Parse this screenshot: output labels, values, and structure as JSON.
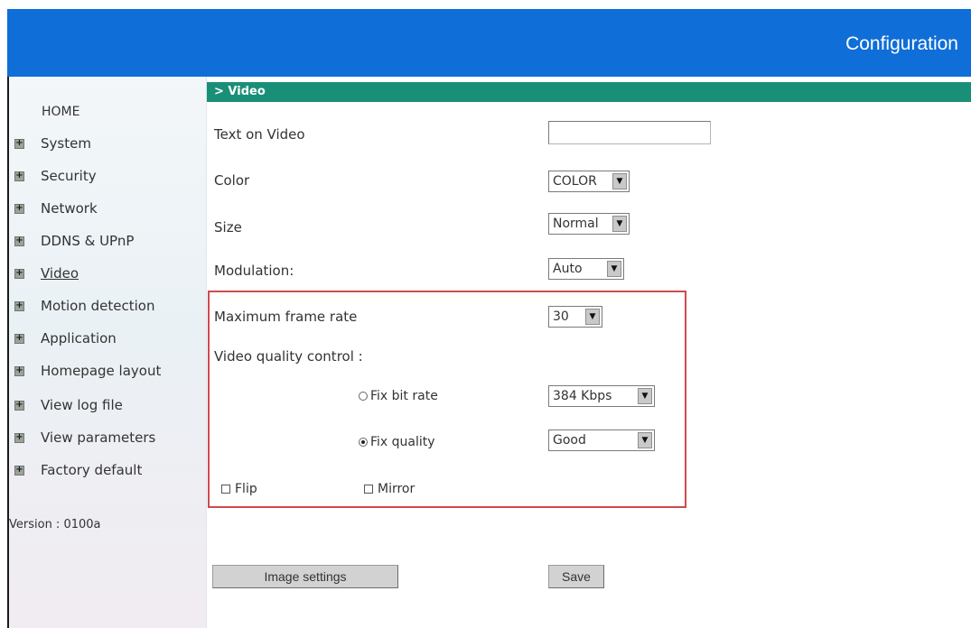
{
  "header": {
    "title": "Configuration"
  },
  "sidebar": {
    "home": "HOME",
    "items": [
      {
        "label": "System",
        "icon": "plus-box-icon"
      },
      {
        "label": "Security",
        "icon": "plus-box-icon"
      },
      {
        "label": "Network",
        "icon": "plus-box-icon"
      },
      {
        "label": "DDNS & UPnP",
        "icon": "plus-box-icon"
      },
      {
        "label": "Video",
        "icon": "plus-box-icon"
      },
      {
        "label": "Motion detection",
        "icon": "plus-box-icon"
      },
      {
        "label": "Application",
        "icon": "plus-box-icon"
      },
      {
        "label": "Homepage layout",
        "icon": "plus-box-icon"
      },
      {
        "label": "View log file",
        "icon": "plus-box-icon"
      },
      {
        "label": "View parameters",
        "icon": "plus-box-icon"
      },
      {
        "label": "Factory default",
        "icon": "plus-box-icon"
      }
    ],
    "version": "Version : 0100a"
  },
  "main": {
    "section_title": "> Video",
    "text_on_video": {
      "label": "Text on Video",
      "value": ""
    },
    "color": {
      "label": "Color",
      "value": "COLOR"
    },
    "size": {
      "label": "Size",
      "value": "Normal"
    },
    "modulation": {
      "label": "Modulation:",
      "value": "Auto"
    },
    "max_frame_rate": {
      "label": "Maximum frame rate",
      "value": "30"
    },
    "quality_control": {
      "label": "Video quality control :",
      "fix_bit_rate": {
        "label": "Fix bit rate",
        "selected": false,
        "value": "384 Kbps"
      },
      "fix_quality": {
        "label": "Fix quality",
        "selected": true,
        "value": "Good"
      }
    },
    "flip": {
      "label": "Flip",
      "checked": false
    },
    "mirror": {
      "label": "Mirror",
      "checked": false
    },
    "image_settings_button": "Image settings",
    "save_button": "Save"
  },
  "colors": {
    "header_bg": "#0f6ed8",
    "section_head_bg": "#1a8f78",
    "highlight_border": "#cf4b4b"
  }
}
